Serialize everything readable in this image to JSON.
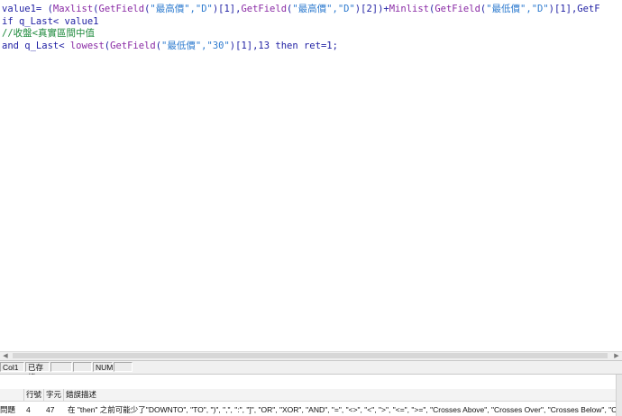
{
  "editor": {
    "lines": [
      [
        {
          "t": "value1= (",
          "c": "plain"
        },
        {
          "t": "Maxlist",
          "c": "func"
        },
        {
          "t": "(",
          "c": "plain"
        },
        {
          "t": "GetField",
          "c": "func"
        },
        {
          "t": "(",
          "c": "plain"
        },
        {
          "t": "\"最高價\",\"D\"",
          "c": "str"
        },
        {
          "t": ")[1],",
          "c": "plain"
        },
        {
          "t": "GetField",
          "c": "func"
        },
        {
          "t": "(",
          "c": "plain"
        },
        {
          "t": "\"最高價\",\"D\"",
          "c": "str"
        },
        {
          "t": ")[2])+",
          "c": "plain"
        },
        {
          "t": "Minlist",
          "c": "func"
        },
        {
          "t": "(",
          "c": "plain"
        },
        {
          "t": "GetField",
          "c": "func"
        },
        {
          "t": "(",
          "c": "plain"
        },
        {
          "t": "\"最低價\",\"D\"",
          "c": "str"
        },
        {
          "t": ")[1],GetF",
          "c": "plain"
        }
      ],
      [
        {
          "t": "if q_Last< value1",
          "c": "plain"
        }
      ],
      [
        {
          "t": "//收盤<真實區間中值",
          "c": "comment"
        }
      ],
      [
        {
          "t": "and q_Last< ",
          "c": "plain"
        },
        {
          "t": "lowest",
          "c": "func"
        },
        {
          "t": "(",
          "c": "plain"
        },
        {
          "t": "GetField",
          "c": "func"
        },
        {
          "t": "(",
          "c": "plain"
        },
        {
          "t": "\"最低價\",\"30\"",
          "c": "str"
        },
        {
          "t": ")[1],13 then ret=1;",
          "c": "plain"
        }
      ]
    ]
  },
  "statusbar": {
    "cells": [
      "Col1",
      "已存檔",
      "",
      "",
      "NUM",
      ""
    ]
  },
  "output": {
    "headers": {
      "col0": "",
      "line": "行號",
      "char": "字元",
      "desc": "錯誤描述"
    },
    "row": {
      "type": "問題",
      "line": "4",
      "char": "47",
      "desc": "在 \"then\" 之前可能少了\"DOWNTO\", \"TO\", \")\", \",\", \":\", \"]\", \"OR\", \"XOR\", \"AND\", \"=\", \"<>\", \"<\", \">\", \"<=\", \">=\", \"Crosses Above\", \"Crosses Over\", \"Crosses Below\", \"Crosses Under\""
    }
  }
}
